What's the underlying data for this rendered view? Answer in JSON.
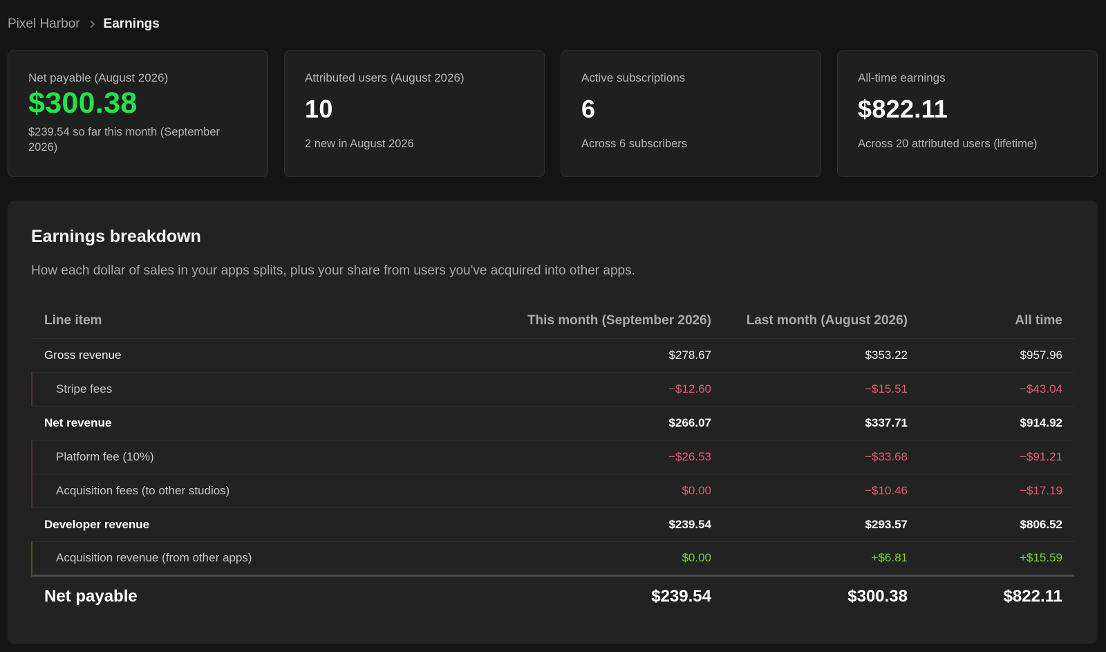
{
  "breadcrumb": {
    "root": "Pixel Harbor",
    "separator_icon": "chevron-right-icon",
    "current": "Earnings"
  },
  "cards": [
    {
      "label": "Net payable (August 2026)",
      "value": "$300.38",
      "sub": "$239.54 so far this month (September 2026)",
      "value_color": "#22e54a"
    },
    {
      "label": "Attributed users (August 2026)",
      "value": "10",
      "sub": "2 new in August 2026"
    },
    {
      "label": "Active subscriptions",
      "value": "6",
      "sub": "Across 6 subscribers"
    },
    {
      "label": "All-time earnings",
      "value": "$822.11",
      "sub": "Across 20 attributed users (lifetime)"
    }
  ],
  "breakdown": {
    "title": "Earnings breakdown",
    "description": "How each dollar of sales in your apps splits, plus your share from users you've acquired into other apps.",
    "columns": [
      "Line item",
      "This month (September 2026)",
      "Last month (August 2026)",
      "All time"
    ],
    "rows": [
      {
        "item": "Gross revenue",
        "this_month": "$278.67",
        "last_month": "$353.22",
        "all_time": "$957.96"
      },
      {
        "item": "Stripe fees",
        "this_month": "−$12.60",
        "last_month": "−$15.51",
        "all_time": "−$43.04"
      },
      {
        "item": "Net revenue",
        "this_month": "$266.07",
        "last_month": "$337.71",
        "all_time": "$914.92"
      },
      {
        "item": "Platform fee (10%)",
        "this_month": "−$26.53",
        "last_month": "−$33.68",
        "all_time": "−$91.21"
      },
      {
        "item": "Acquisition fees (to other studios)",
        "this_month": "$0.00",
        "last_month": "−$10.46",
        "all_time": "−$17.19"
      },
      {
        "item": "Developer revenue",
        "this_month": "$239.54",
        "last_month": "$293.57",
        "all_time": "$806.52"
      },
      {
        "item": "Acquisition revenue (from other apps)",
        "this_month": "$0.00",
        "last_month": "+$6.81",
        "all_time": "+$15.59"
      }
    ],
    "total": {
      "item": "Net payable",
      "this_month": "$239.54",
      "last_month": "$300.38",
      "all_time": "$822.11"
    }
  },
  "colors": {
    "accent_green": "#22e54a",
    "negative": "#e05c70",
    "positive": "#7ed321"
  }
}
